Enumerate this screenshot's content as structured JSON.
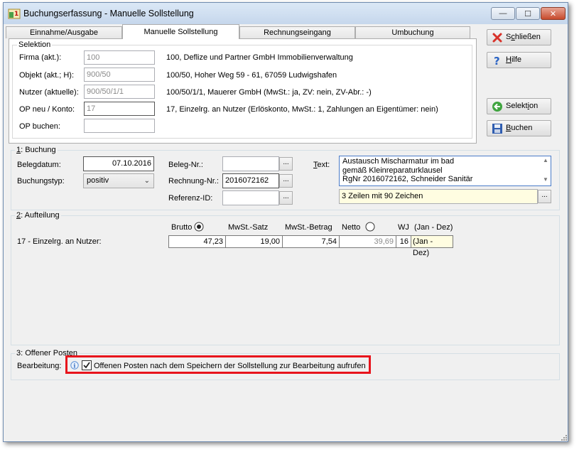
{
  "window": {
    "title": "Buchungserfassung - Manuelle Sollstellung",
    "controls": {
      "minimize": "—",
      "maximize": "☐",
      "close": "✕"
    }
  },
  "tabs": [
    {
      "label": "Einnahme/Ausgabe",
      "active": false
    },
    {
      "label": "Manuelle Sollstellung",
      "active": true
    },
    {
      "label": "Rechnungseingang",
      "active": false
    },
    {
      "label": "Umbuchung",
      "active": false
    }
  ],
  "selektion": {
    "title": "Selektion",
    "rows": [
      {
        "label": "Firma (akt.):",
        "value": "100",
        "info": "100,  Deflize und Partner GmbH Immobilienverwaltung"
      },
      {
        "label": "Objekt (akt.; H):",
        "value": "900/50",
        "info": "100/50,  Hoher Weg 59 - 61, 67059 Ludwigshafen"
      },
      {
        "label": "Nutzer (aktuelle):",
        "value": "900/50/1/1",
        "info": "100/50/1/1,  Mauerer GmbH  (MwSt.: ja,  ZV: nein, ZV-Abr.: -)"
      },
      {
        "label": "OP neu / Konto:",
        "value": "17",
        "info": "17,  Einzelrg. an Nutzer  (Erlöskonto,  MwSt.: 1,  Zahlungen an Eigentümer: nein)"
      },
      {
        "label": "OP buchen:",
        "value": "",
        "info": ""
      }
    ]
  },
  "side_buttons": {
    "close": {
      "pre": "S",
      "ul": "c",
      "post": "hließen"
    },
    "help": {
      "pre": "",
      "ul": "H",
      "post": "ilfe"
    },
    "selection": {
      "pre": "Selekt",
      "ul": "i",
      "post": "on"
    },
    "book": {
      "pre": "",
      "ul": "B",
      "post": "uchen"
    }
  },
  "buchung": {
    "title_num": "1",
    "title_rest": ": Buchung",
    "belegdatum_label": "Belegdatum:",
    "belegdatum": "07.10.2016",
    "buchungstyp_label": "Buchungstyp:",
    "buchungstyp": "positiv",
    "belegnr_label": "Beleg-Nr.:",
    "belegnr": "",
    "rechnungnr_label": "Rechnung-Nr.:",
    "rechnungnr": "2016072162",
    "referenz_label": "Referenz-ID:",
    "referenz": "",
    "text_label_ul": "T",
    "text_label_rest": "ext:",
    "text_lines": [
      "Austausch Mischarmatur im bad",
      "gemäß Kleinreparaturklausel",
      "RgNr 2016072162, Schneider Sanitär"
    ],
    "text_status": "3 Zeilen mit 90 Zeichen",
    "browse": "..."
  },
  "aufteilung": {
    "title_num": "2",
    "title_rest": ": Aufteilung",
    "headers": {
      "brutto": "Brutto",
      "mwst_satz": "MwSt.-Satz",
      "mwst_betrag": "MwSt.-Betrag",
      "netto": "Netto",
      "wj": "WJ",
      "jan_dez": "(Jan - Dez)"
    },
    "row": {
      "label": "17 - Einzelrg. an Nutzer:",
      "brutto": "47,23",
      "mwst_satz": "19,00",
      "mwst_betrag": "7,54",
      "netto": "39,69",
      "wj": "16",
      "period": "(Jan - Dez)"
    }
  },
  "offener_posten": {
    "title": "3: Offener Posten",
    "bearbeitung_label": "Bearbeitung:",
    "checkbox_label": "Offenen Posten nach dem Speichern der Sollstellung zur Bearbeitung aufrufen",
    "checked": true
  },
  "colors": {
    "highlight": "#e8141c",
    "hint_bg": "#fffde1"
  }
}
